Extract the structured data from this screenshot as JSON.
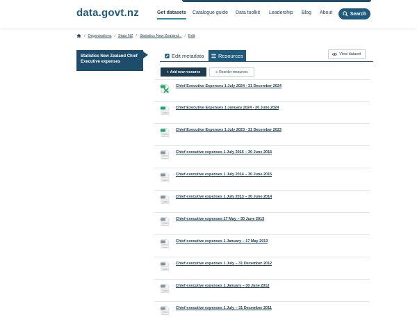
{
  "header": {
    "logo": "data.govt.nz",
    "nav": [
      "Get datasets",
      "Catalogue guide",
      "Data toolkit",
      "Leadership",
      "Blog",
      "About"
    ],
    "search_label": "Search"
  },
  "breadcrumb": [
    "Organisations",
    "Stats NZ",
    "Statistics New Zealand...",
    "Edit"
  ],
  "sidebar": {
    "org_name": "Statistics New Zealand Chief Executive expenses"
  },
  "tabs": {
    "edit_metadata": "Edit metadata",
    "resources": "Resources"
  },
  "view_dataset_label": "View dataset",
  "actions": {
    "add_resource": "Add new resource",
    "reorder_resources": "Reorder resources"
  },
  "resources": [
    {
      "title": "Chief Executive Expenses 1 July 2024 - 31 December 2024",
      "format": "xlsx-green"
    },
    {
      "title": "Chief Executive Expenses 1 January 2024 - 30 June 2024",
      "format": "spreadsheet"
    },
    {
      "title": "Chief Executive Expenses 1 July 2023 - 31 December 2023",
      "format": "spreadsheet"
    },
    {
      "title": "Chief executive expenses 1 July 2015 – 30 June 2016",
      "format": "generic"
    },
    {
      "title": "Chief executive expenses 1 July 2014 – 30 June 2015",
      "format": "generic"
    },
    {
      "title": "Chief executive expenses 1 July 2013 – 30 June 2014",
      "format": "generic"
    },
    {
      "title": "Chief executive expenses 17 May – 30 June 2013",
      "format": "generic"
    },
    {
      "title": "Chief executive expenses 1 January – 17 May 2013",
      "format": "generic"
    },
    {
      "title": "Chief executive expenses 1 July – 31 December 2012",
      "format": "generic"
    },
    {
      "title": "Chief executive expenses 1 January – 30 June 2012",
      "format": "generic"
    },
    {
      "title": "Chief executive expenses 1 July – 31 December 2011",
      "format": "generic"
    }
  ],
  "colors": {
    "brand": "#1f5a7c",
    "dark": "#1d3b4f",
    "excel_green": "#21a366"
  }
}
